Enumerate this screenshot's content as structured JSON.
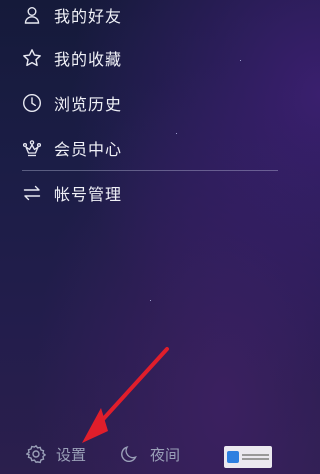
{
  "menu": {
    "items": [
      {
        "label": "我的好友",
        "icon": "friends-icon"
      },
      {
        "label": "我的收藏",
        "icon": "star-icon"
      },
      {
        "label": "浏览历史",
        "icon": "clock-icon"
      },
      {
        "label": "会员中心",
        "icon": "crown-icon"
      },
      {
        "label": "帐号管理",
        "icon": "switch-account-icon"
      }
    ]
  },
  "footer": {
    "settings_label": "设置",
    "night_label": "夜间"
  },
  "colors": {
    "background": "#1b1d46",
    "text": "#f0f1f7",
    "muted_text": "#9aa0b8",
    "arrow": "#e01e2b"
  }
}
